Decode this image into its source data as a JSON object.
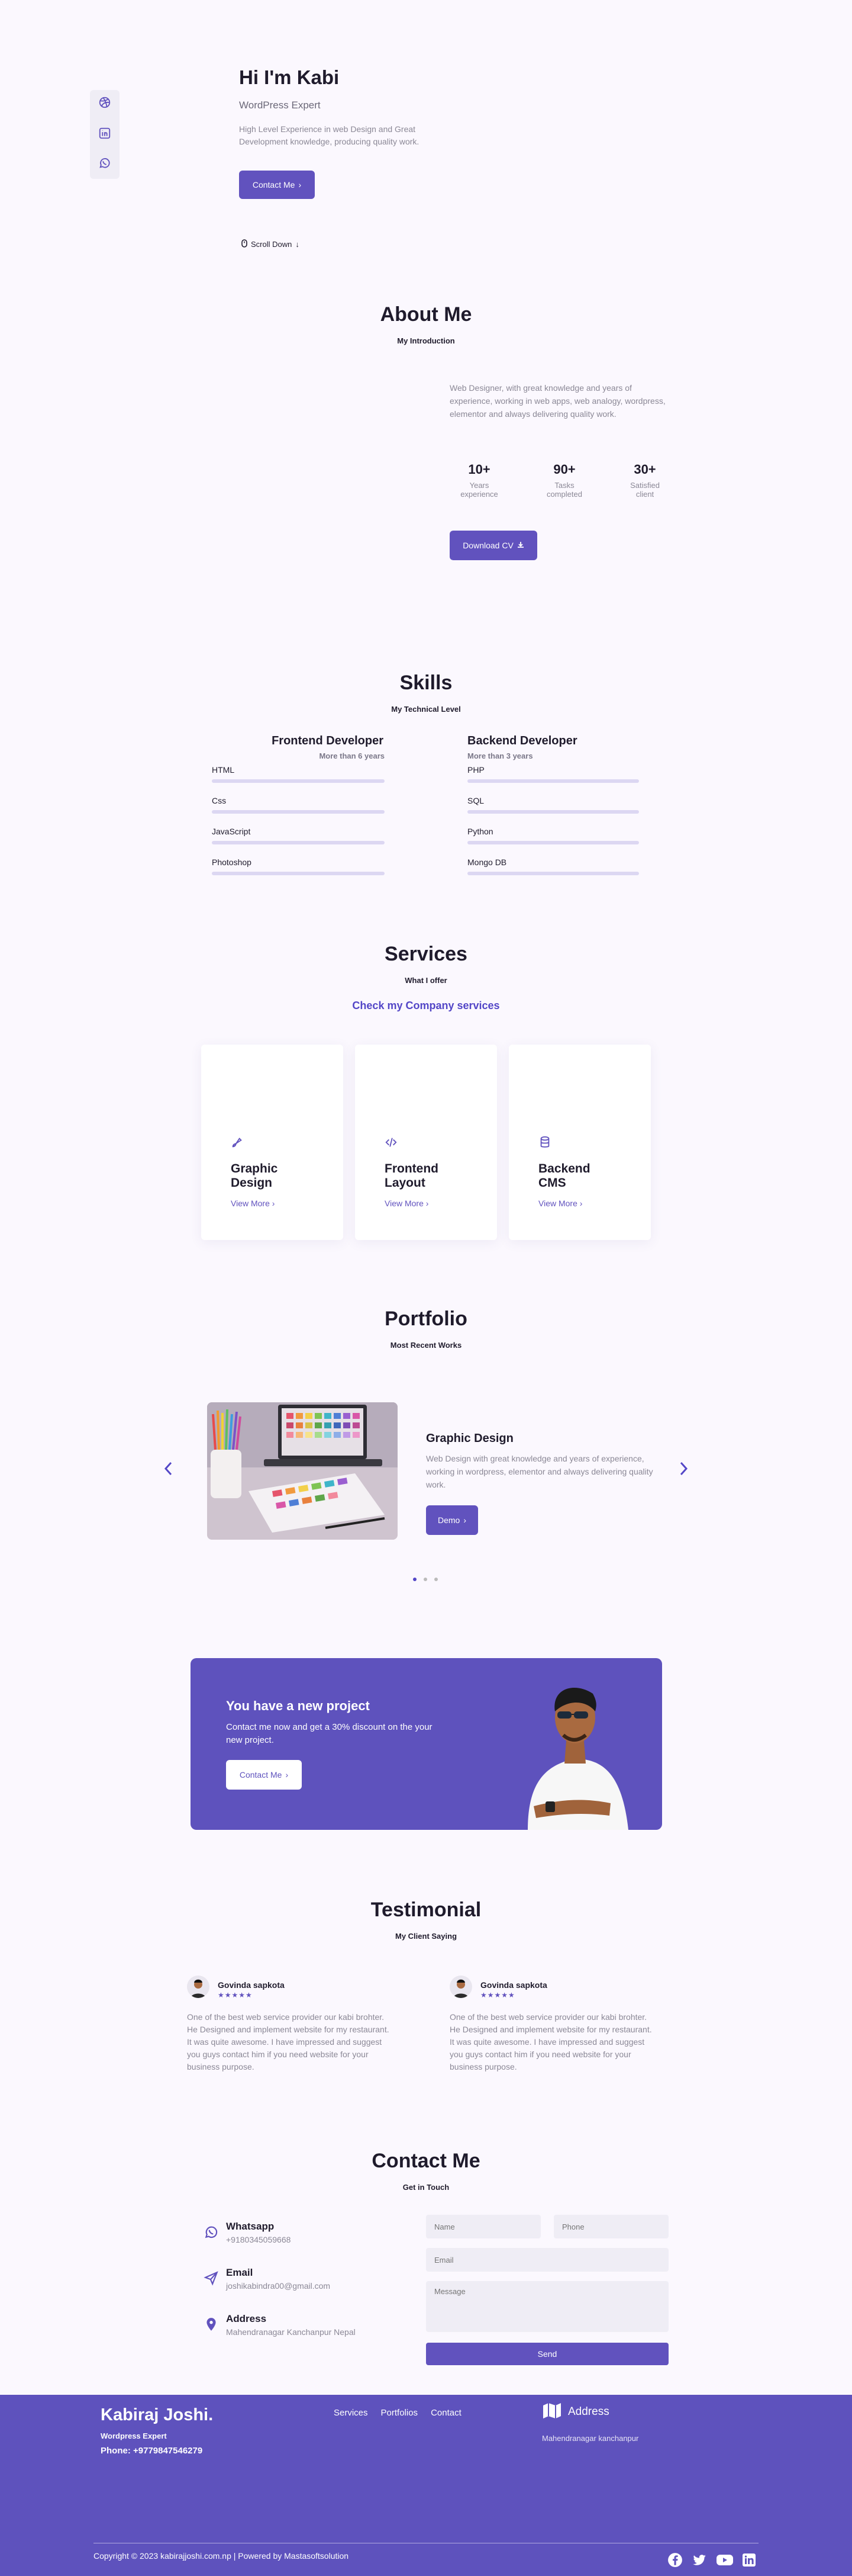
{
  "hero": {
    "title": "Hi I'm Kabi",
    "subtitle": "WordPress Expert",
    "description": "High Level Experience in web Design and Great Development knowledge, producing quality work.",
    "contact_label": "Contact Me",
    "scroll_label": "Scroll Down"
  },
  "about": {
    "title": "About Me",
    "subtitle": "My Introduction",
    "description": "Web Designer, with great knowledge and years of experience, working in web apps, web analogy, wordpress, elementor and always delivering quality work.",
    "stats": [
      {
        "value": "10+",
        "label1": "Years",
        "label2": "experience"
      },
      {
        "value": "90+",
        "label1": "Tasks",
        "label2": "completed"
      },
      {
        "value": "30+",
        "label1": "Satisfied",
        "label2": "client"
      }
    ],
    "download_label": "Download CV"
  },
  "skills": {
    "title": "Skills",
    "subtitle": "My Technical Level",
    "frontend": {
      "title": "Frontend Developer",
      "subtitle": "More than 6 years",
      "items": [
        "HTML",
        "Css",
        "JavaScript",
        "Photoshop"
      ]
    },
    "backend": {
      "title": "Backend Developer",
      "subtitle": "More than 3 years",
      "items": [
        "PHP",
        "SQL",
        "Python",
        "Mongo DB"
      ]
    }
  },
  "services": {
    "title": "Services",
    "subtitle": "What I offer",
    "link": "Check my Company services",
    "cards": [
      {
        "line1": "Graphic",
        "line2": "Design",
        "icon": "graphic-design-icon"
      },
      {
        "line1": "Frontend",
        "line2": "Layout",
        "icon": "code-icon"
      },
      {
        "line1": "Backend",
        "line2": "CMS",
        "icon": "server-icon"
      }
    ],
    "view_more": "View More"
  },
  "portfolio": {
    "title": "Portfolio",
    "subtitle": "Most Recent Works",
    "item_title": "Graphic Design",
    "item_description": "Web Design with great knowledge and years of experience, working in wordpress, elementor and always delivering quality work.",
    "demo_label": "Demo"
  },
  "project": {
    "title": "You have a new project",
    "description": "Contact me now and get a 30% discount on the your new project.",
    "button_label": "Contact Me"
  },
  "testimonial": {
    "title": "Testimonial",
    "subtitle": "My Client Saying",
    "items": [
      {
        "name": "Govinda sapkota",
        "stars": "★★★★★",
        "text": "One of the best web service provider our kabi brohter. He Designed and implement website for my restaurant. It was quite awesome. I have impressed and suggest you guys contact him if you need website for your business purpose."
      },
      {
        "name": "Govinda sapkota",
        "stars": "★★★★★",
        "text": "One of the best web service provider our kabi brohter. He Designed and implement website for my restaurant. It was quite awesome. I have impressed and suggest you guys contact him if you need website for your business purpose."
      }
    ]
  },
  "contact": {
    "title": "Contact Me",
    "subtitle": "Get in Touch",
    "whatsapp_title": "Whatsapp",
    "whatsapp_value": "+9180345059668",
    "email_title": "Email",
    "email_value": "joshikabindra00@gmail.com",
    "address_title": "Address",
    "address_value": "Mahendranagar Kanchanpur Nepal",
    "name_placeholder": "Name",
    "phone_placeholder": "Phone",
    "email_placeholder": "Email",
    "message_placeholder": "Message",
    "send_label": "Send"
  },
  "footer": {
    "brand": "Kabiraj Joshi.",
    "role": "Wordpress Expert",
    "phone": "Phone: +9779847546279",
    "nav": [
      "Services",
      "Portfolios",
      "Contact"
    ],
    "address_title": "Address",
    "address_value": "Mahendranagar kanchanpur",
    "copyright": "Copyright © 2023 kabirajjoshi.com.np | Powered by Mastasoftsolution"
  },
  "colors": {
    "accent": "#6152be",
    "background": "#fbf8fe",
    "footer": "#5e52bd"
  }
}
